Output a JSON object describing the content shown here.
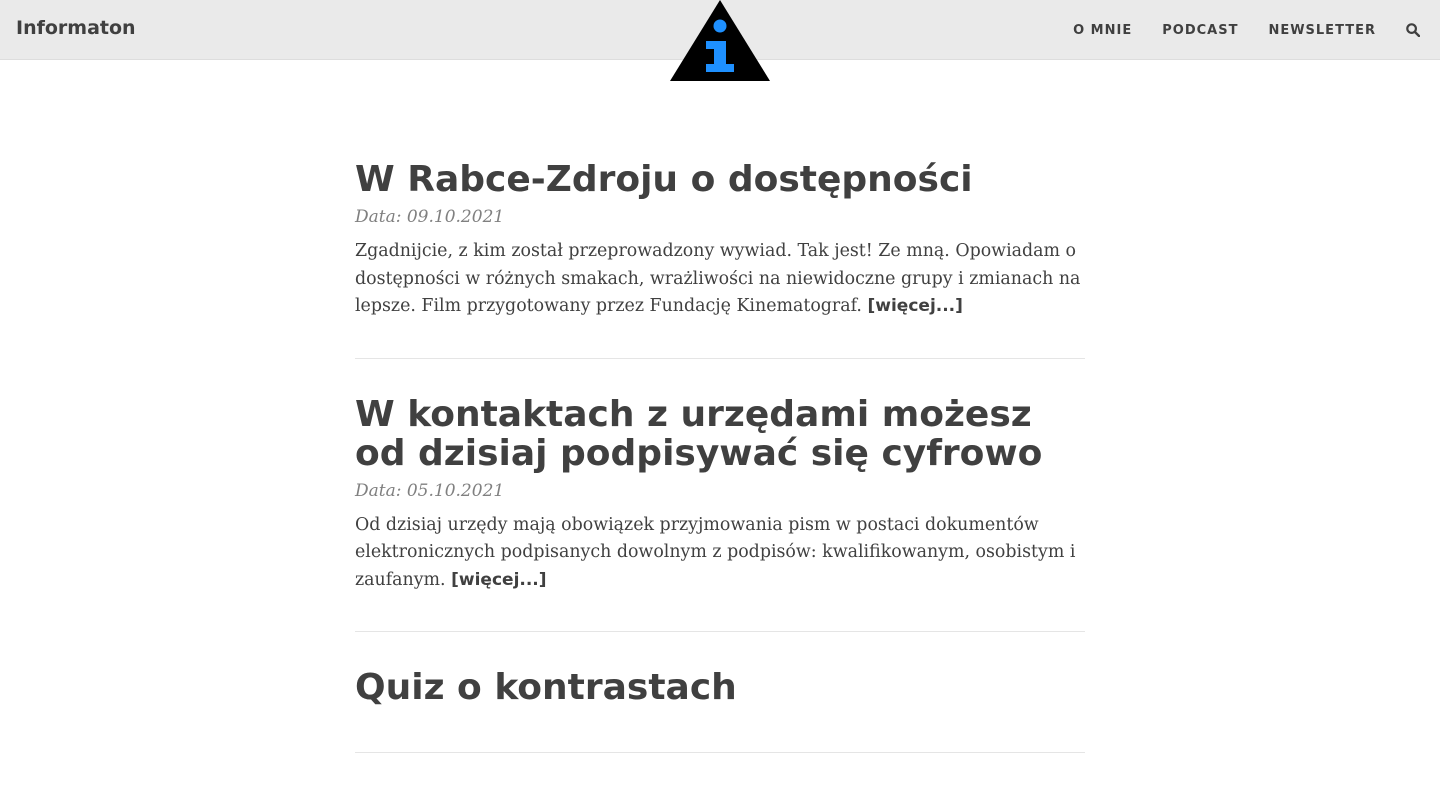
{
  "site": {
    "brand": "Informaton",
    "logo_icon": "info-triangle-logo",
    "colors": {
      "logo_triangle": "#000000",
      "logo_info": "#1e90ff",
      "navbar_bg": "#eaeaea",
      "text": "#404040",
      "meta": "#808080"
    }
  },
  "nav": {
    "items": [
      {
        "label": "O MNIE"
      },
      {
        "label": "PODCAST"
      },
      {
        "label": "NEWSLETTER"
      }
    ],
    "search_icon": "search-icon"
  },
  "posts": [
    {
      "title": "W Rabce-Zdroju o dostępności",
      "date": "Data: 09.10.2021",
      "excerpt": "Zgadnijcie, z kim został przeprowadzony wywiad. Tak jest! Ze mną. Opowiadam o dostępności w różnych smakach, wrażliwości na niewidoczne grupy i zmianach na lepsze. Film przygotowany przez Fundację Kinematograf.",
      "more": "[więcej...]"
    },
    {
      "title": "W kontaktach z urzędami możesz od dzisiaj podpisywać się cyfrowo",
      "date": "Data: 05.10.2021",
      "excerpt": "Od dzisiaj urzędy mają obowiązek przyjmowania pism w postaci dokumentów elektronicznych podpisanych dowolnym z podpisów: kwalifikowanym, osobistym i zaufanym.",
      "more": "[więcej...]"
    },
    {
      "title": "Quiz o kontrastach"
    }
  ]
}
